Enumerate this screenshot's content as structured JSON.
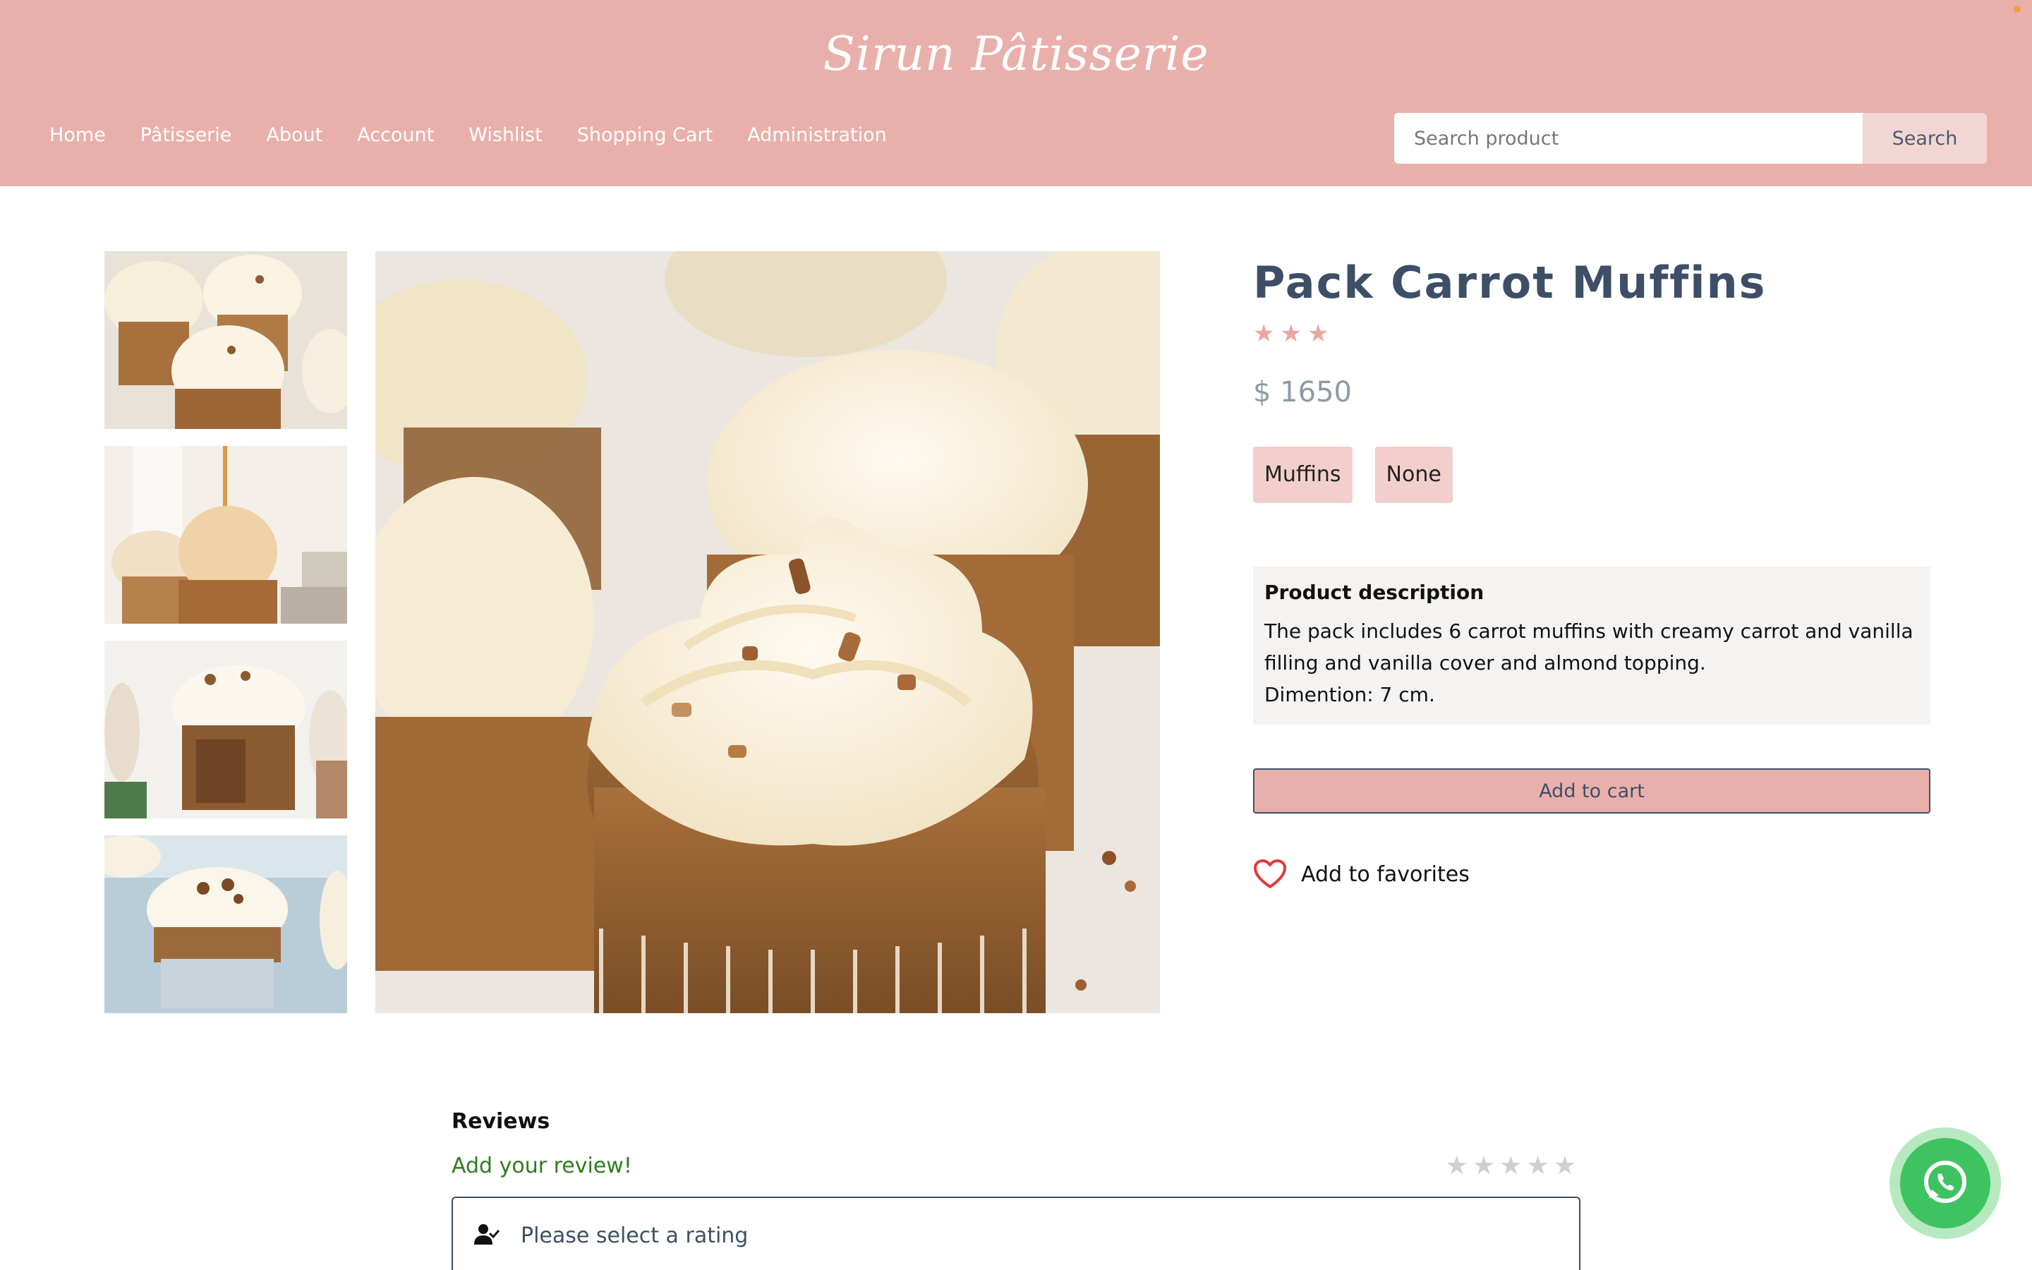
{
  "brand": "Sirun Pâtisserie",
  "nav": {
    "items": [
      "Home",
      "Pâtisserie",
      "About",
      "Account",
      "Wishlist",
      "Shopping Cart",
      "Administration"
    ]
  },
  "search": {
    "placeholder": "Search product",
    "button_label": "Search"
  },
  "product": {
    "title": "Pack Carrot Muffins",
    "rating": 3,
    "price": "$ 1650",
    "tags": [
      "Muffins",
      "None"
    ],
    "description_title": "Product description",
    "description_lines": [
      "The pack includes 6 carrot muffins with creamy carrot and vanilla",
      "filling and vanilla cover and almond topping.",
      "Dimention: 7 cm."
    ],
    "add_to_cart_label": "Add to cart",
    "favorites_label": "Add to favorites"
  },
  "reviews": {
    "title": "Reviews",
    "add_review_label": "Add your review!",
    "rating_placeholder": "Please select a rating",
    "max_stars": 5
  },
  "colors": {
    "header_bg": "#e9b0ab",
    "title_color": "#3d4f66",
    "star_filled": "#e9a6a2",
    "review_link": "#2e7d1e",
    "whatsapp": "#3ec360",
    "favorite_heart": "#e03a3a"
  },
  "icons": {
    "rating": "star-icon",
    "favorite": "heart-icon",
    "user": "user-check-icon",
    "chat": "whatsapp-icon"
  }
}
